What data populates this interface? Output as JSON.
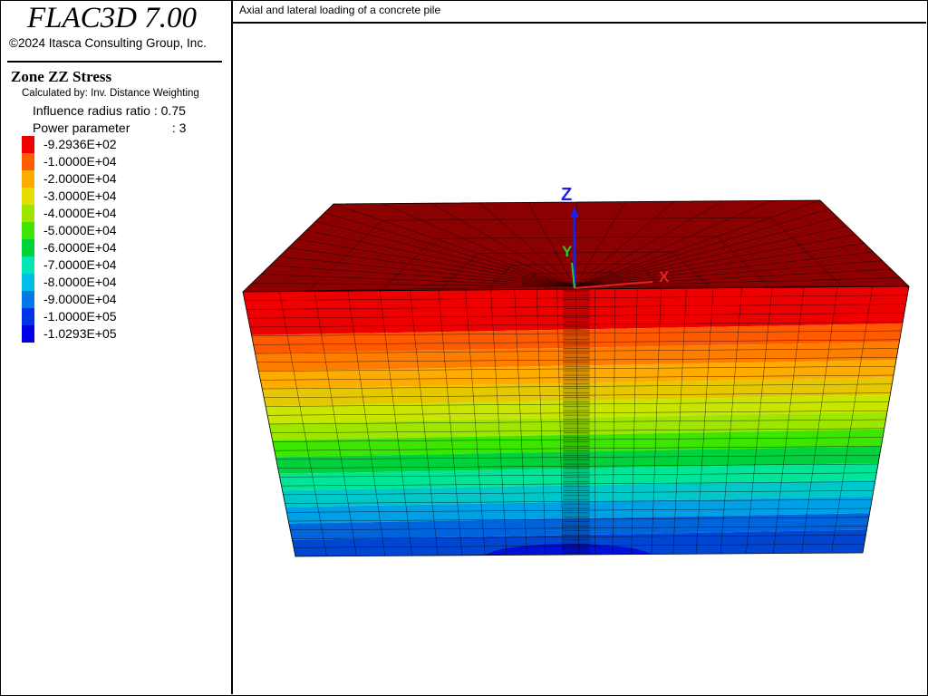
{
  "app": {
    "title": "FLAC3D 7.00",
    "copyright": "©2024 Itasca Consulting Group, Inc."
  },
  "legend": {
    "title": "Zone ZZ Stress",
    "method": "Calculated by: Inv. Distance Weighting",
    "influence_label": "Influence radius ratio",
    "influence_value": ": 0.75",
    "power_label": "Power parameter",
    "power_value": ": 3",
    "items": [
      {
        "label": "-9.2936E+02",
        "color": "#ee0000"
      },
      {
        "label": "-1.0000E+04",
        "color": "#ff5d00"
      },
      {
        "label": "-2.0000E+04",
        "color": "#ffab00"
      },
      {
        "label": "-3.0000E+04",
        "color": "#e6de00"
      },
      {
        "label": "-4.0000E+04",
        "color": "#9ee600"
      },
      {
        "label": "-5.0000E+04",
        "color": "#3ce600"
      },
      {
        "label": "-6.0000E+04",
        "color": "#00d23c"
      },
      {
        "label": "-7.0000E+04",
        "color": "#00e6b4"
      },
      {
        "label": "-8.0000E+04",
        "color": "#00bee6"
      },
      {
        "label": "-9.0000E+04",
        "color": "#0078e6"
      },
      {
        "label": "-1.0000E+05",
        "color": "#0032e6"
      },
      {
        "label": "-1.0293E+05",
        "color": "#0000e6"
      }
    ]
  },
  "view": {
    "title": "Axial and lateral loading of a concrete pile",
    "top_face_color": "#8b0000",
    "band_colors": [
      "#ee0000",
      "#ff5a00",
      "#ff7e00",
      "#ffab00",
      "#e6c800",
      "#c8e600",
      "#9ee600",
      "#3ce600",
      "#00d23c",
      "#00e696",
      "#00c8c8",
      "#00a0e6",
      "#0064dc",
      "#0046d2"
    ],
    "axes": {
      "z": {
        "label": "Z",
        "color": "#1f1fe6"
      },
      "y": {
        "label": "Y",
        "color": "#2ec82e"
      },
      "x": {
        "label": "X",
        "color": "#e62020"
      }
    }
  }
}
